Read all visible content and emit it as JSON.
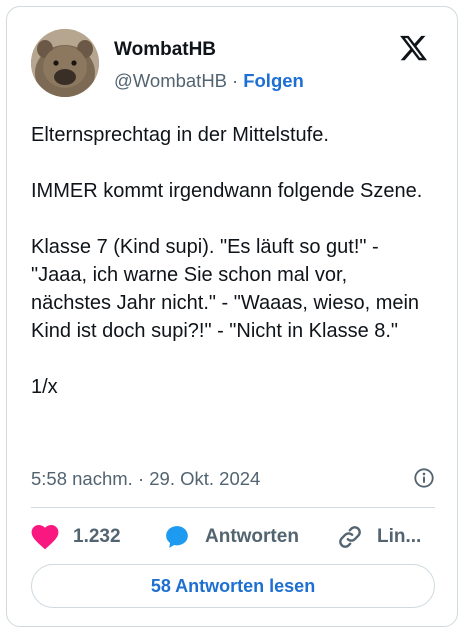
{
  "author": {
    "name": "WombatHB",
    "handle": "@WombatHB",
    "separator": "·",
    "follow_label": "Folgen"
  },
  "tweet": {
    "paragraphs": [
      "Elternsprechtag in der Mittelstufe.",
      "IMMER kommt irgendwann folgende Szene.",
      "Klasse 7 (Kind supi). \"Es läuft so gut!\" - \"Jaaa, ich warne Sie schon mal vor, nächstes Jahr nicht.\" - \"Waaas, wieso, mein Kind ist doch supi?!\" - \"Nicht in Klasse 8.\"",
      "1/x"
    ],
    "timestamp": "5:58 nachm. · 29. Okt. 2024"
  },
  "actions": {
    "likes_count": "1.232",
    "reply_label": "Antworten",
    "link_label": "Lin..."
  },
  "read_replies_label": "58 Antworten lesen",
  "icons": {
    "logo": "x-logo-icon",
    "info": "info-icon",
    "like": "heart-icon",
    "reply": "speech-bubble-icon",
    "link": "link-icon"
  },
  "colors": {
    "accent_blue": "#1d6fd1",
    "heart_red": "#f91880",
    "reply_blue": "#1d9bf0",
    "secondary_text": "#536471"
  }
}
